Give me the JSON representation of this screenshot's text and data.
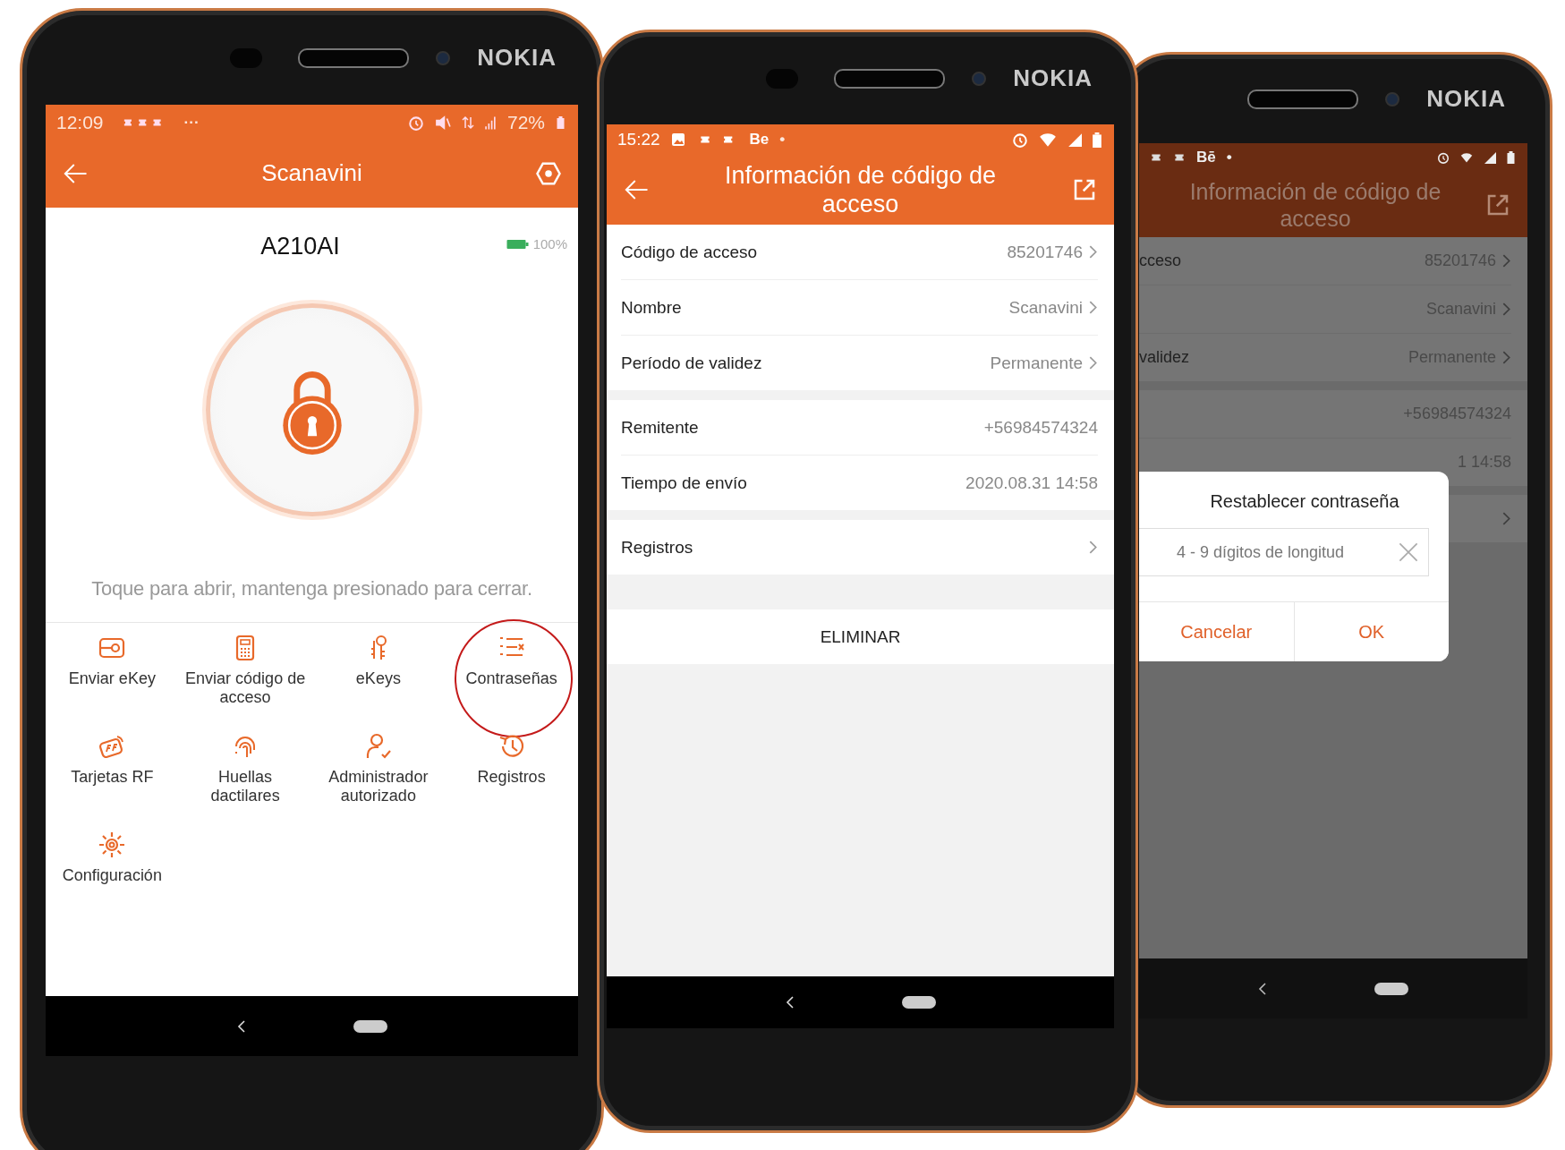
{
  "phone_home": {
    "brand": "NOKIA",
    "status_bar": {
      "time": "12:09",
      "extra": "···",
      "battery": "72%"
    },
    "header": {
      "title": "Scanavini"
    },
    "device": {
      "name": "A210AI",
      "battery": "100%"
    },
    "hint": "Toque para abrir, mantenga presionado para cerrar.",
    "menu": [
      {
        "kind": "ekey",
        "label": "Enviar eKey",
        "highlighted": false
      },
      {
        "kind": "code",
        "label": "Enviar código de\nacceso",
        "highlighted": false
      },
      {
        "kind": "keys",
        "label": "eKeys",
        "highlighted": false
      },
      {
        "kind": "passwords",
        "label": "Contraseñas",
        "highlighted": true
      },
      {
        "kind": "rf",
        "label": "Tarjetas RF",
        "highlighted": false
      },
      {
        "kind": "fingerprint",
        "label": "Huellas\ndactilares",
        "highlighted": false
      },
      {
        "kind": "admin",
        "label": "Administrador\nautorizado",
        "highlighted": false
      },
      {
        "kind": "records",
        "label": "Registros",
        "highlighted": false
      },
      {
        "kind": "settings",
        "label": "Configuración",
        "highlighted": false
      }
    ]
  },
  "phone_code_info": {
    "brand": "NOKIA",
    "status_bar": {
      "time": "15:22",
      "app_badge": "Be",
      "extra": "•"
    },
    "header": {
      "title": "Información de código de acceso"
    },
    "groups": [
      [
        {
          "label": "Código de acceso",
          "value": "85201746",
          "chevron": true
        },
        {
          "label": "Nombre",
          "value": "Scanavini",
          "chevron": true
        },
        {
          "label": "Período de validez",
          "value": "Permanente",
          "chevron": true
        }
      ],
      [
        {
          "label": "Remitente",
          "value": "+56984574324",
          "chevron": false
        },
        {
          "label": "Tiempo de envío",
          "value": "2020.08.31 14:58",
          "chevron": false
        }
      ],
      [
        {
          "label": "Registros",
          "chevron": true
        }
      ]
    ],
    "delete_button": "ELIMINAR"
  },
  "phone_reset_dialog": {
    "brand": "NOKIA",
    "status_bar": {
      "app_badge": "Bē",
      "extra": "•"
    },
    "header": {
      "title": "Información de código de acceso"
    },
    "groups": [
      [
        {
          "label": "cceso",
          "value": "85201746",
          "chevron": true
        },
        {
          "value": "Scanavini",
          "chevron": true
        },
        {
          "label": "validez",
          "value": "Permanente",
          "chevron": true
        }
      ],
      [
        {
          "value": "+56984574324",
          "chevron": false
        },
        {
          "value": "1 14:58",
          "chevron": false
        }
      ],
      [
        {
          "chevron": true
        }
      ]
    ],
    "dialog": {
      "title": "Restablecer contraseña",
      "placeholder": "4 - 9 dígitos de longitud",
      "buttons": [
        "Cancelar",
        "OK"
      ]
    }
  }
}
